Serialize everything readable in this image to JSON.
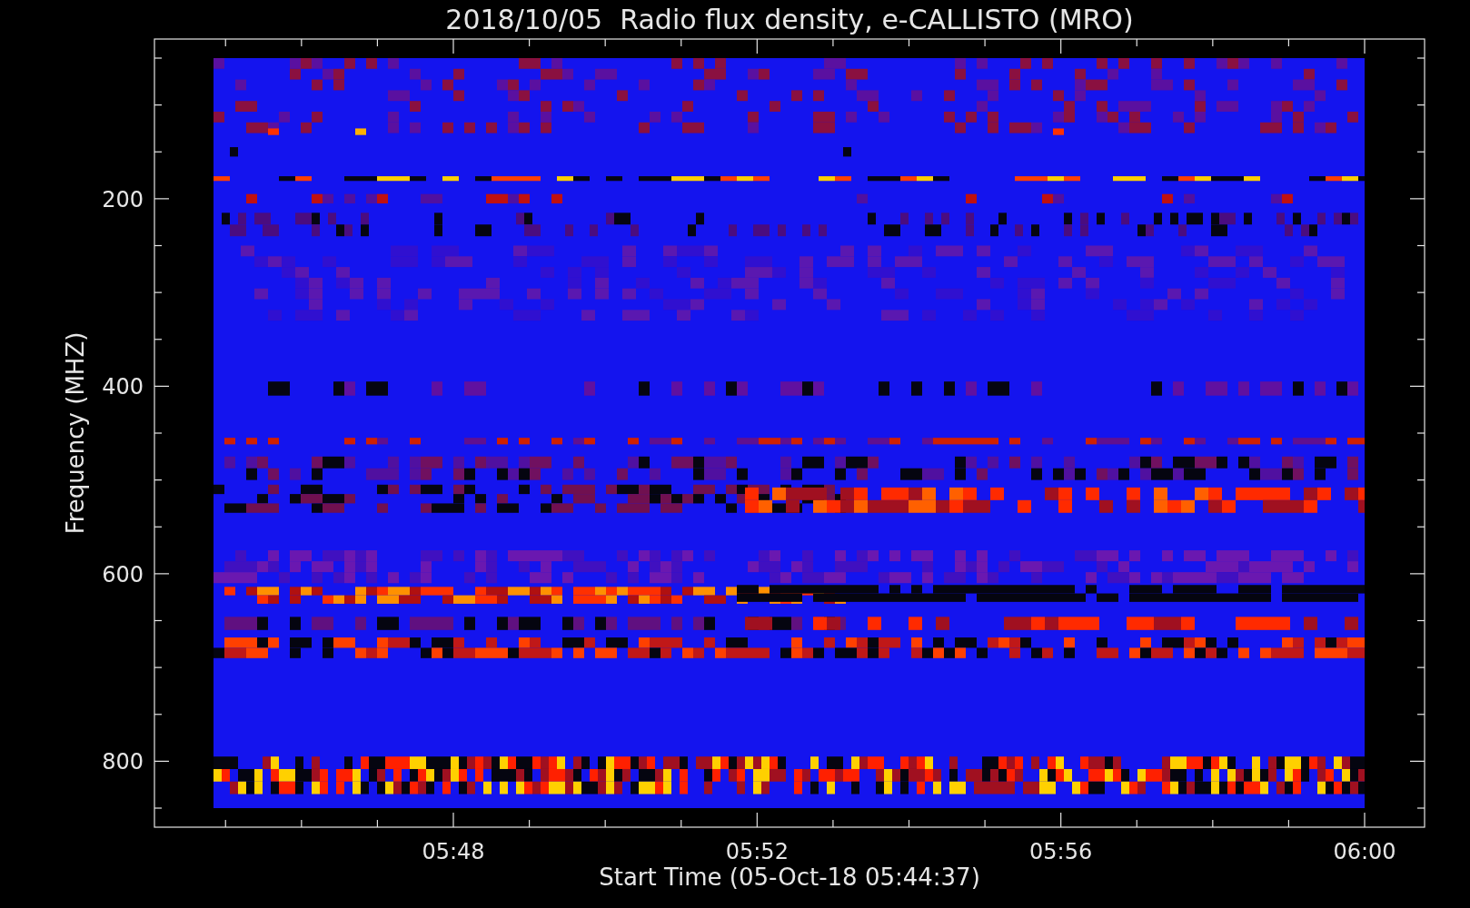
{
  "title": "2018/10/05  Radio flux density, e-CALLISTO (MRO)",
  "y_axis": {
    "label": "Frequency (MHZ)",
    "ticks": [
      "200",
      "400",
      "600",
      "800"
    ]
  },
  "x_axis": {
    "label": "Start Time (05-Oct-18 05:44:37)",
    "ticks": [
      "05:48",
      "05:52",
      "05:56",
      "06:00"
    ]
  }
}
